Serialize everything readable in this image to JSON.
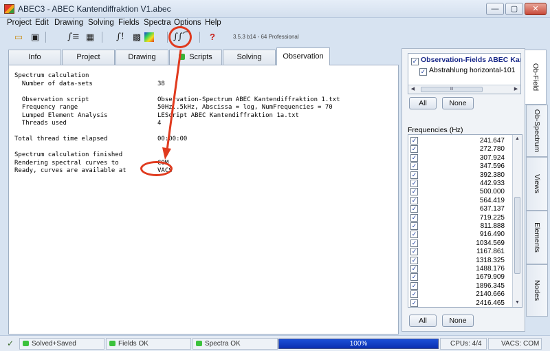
{
  "window": {
    "title": "ABEC3 - ABEC Kantendiffraktion V1.abec",
    "min_glyph": "—",
    "max_glyph": "▢",
    "close_glyph": "✕"
  },
  "menu": [
    "Project",
    "Edit",
    "Drawing",
    "Solving",
    "Fields",
    "Spectra",
    "Options",
    "Help"
  ],
  "toolbar": {
    "version": "3.5.3 b14 - 64 Professional",
    "help_glyph": "?"
  },
  "tabs": [
    {
      "label": "Info"
    },
    {
      "label": "Project"
    },
    {
      "label": "Drawing"
    },
    {
      "label": "Scripts",
      "status": "ok"
    },
    {
      "label": "Solving"
    },
    {
      "label": "Observation",
      "active": true
    }
  ],
  "observation_log": [
    {
      "label": "Spectrum calculation",
      "value": ""
    },
    {
      "label": "  Number of data-sets",
      "value": "38"
    },
    {
      "label": "",
      "value": ""
    },
    {
      "label": "  Observation script",
      "value": "Observation-Spectrum ABEC Kantendiffraktion 1.txt"
    },
    {
      "label": "  Frequency range",
      "value": "50Hz..5kHz, Abscissa = log, NumFrequencies = 70"
    },
    {
      "label": "  Lumped Element Analysis",
      "value": "LEScript ABEC Kantendiffraktion 1a.txt"
    },
    {
      "label": "  Threads used",
      "value": "4"
    },
    {
      "label": "",
      "value": ""
    },
    {
      "label": "Total thread time elapsed",
      "value": "00:00:00"
    },
    {
      "label": "",
      "value": ""
    },
    {
      "label": "Spectrum calculation finished",
      "value": ""
    },
    {
      "label": "Rendering spectral curves to",
      "value": "COM"
    },
    {
      "label": "Ready, curves are available at",
      "value": "VACS"
    }
  ],
  "right_panel": {
    "tree": [
      {
        "label": "Observation-Fields ABEC Kan",
        "checked": true,
        "bold": true
      },
      {
        "label": "Abstrahlung horizontal-101",
        "checked": true,
        "bold": false
      }
    ],
    "scroll_thumb_glyph": "III",
    "all_label": "All",
    "none_label": "None",
    "frequencies_title": "Frequencies  (Hz)",
    "frequencies": [
      "241.647",
      "272.780",
      "307.924",
      "347.596",
      "392.380",
      "442.933",
      "500.000",
      "564.419",
      "637.137",
      "719.225",
      "811.888",
      "916.490",
      "1034.569",
      "1167.861",
      "1318.325",
      "1488.176",
      "1679.909",
      "1896.345",
      "2140.666",
      "2416.465"
    ],
    "check_glyph": "✓"
  },
  "side_tabs": [
    "Ob-Field",
    "Ob-Spectrum",
    "Views",
    "Elements",
    "Nodes"
  ],
  "status_bar": {
    "solved": "Solved+Saved",
    "fields": "Fields OK",
    "spectra": "Spectra OK",
    "progress_percent": 100,
    "progress_label": "100%",
    "cpus": "CPUs: 4/4",
    "vacs": "VACS: COM"
  },
  "colors": {
    "accent_red": "#e03a1e",
    "status_green": "#3cc23c",
    "progress_blue": "#1b4fd8"
  }
}
